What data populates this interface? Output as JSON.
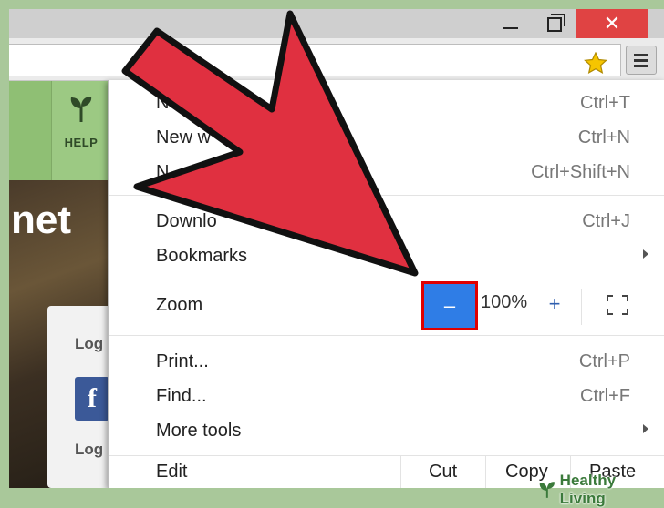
{
  "menu": {
    "items": [
      {
        "label": "N",
        "shortcut": "Ctrl+T"
      },
      {
        "label": "New w",
        "shortcut": "Ctrl+N"
      },
      {
        "label": "N",
        "shortcut": "Ctrl+Shift+N"
      },
      {
        "label": "Downlo",
        "shortcut": "Ctrl+J"
      },
      {
        "label": "Bookmarks",
        "shortcut": ""
      },
      {
        "label": "Print...",
        "shortcut": "Ctrl+P"
      },
      {
        "label": "Find...",
        "shortcut": "Ctrl+F"
      },
      {
        "label": "More tools",
        "shortcut": ""
      }
    ],
    "zoom": {
      "label": "Zoom",
      "minus": "–",
      "value": "100%",
      "plus": "+"
    },
    "edit": {
      "label": "Edit",
      "cut": "Cut",
      "copy": "Copy",
      "paste": "Paste"
    }
  },
  "page": {
    "nav_help": "HELP",
    "hero_text": "net",
    "login_label_1": "Log",
    "login_label_2": "Log",
    "facebook_letter": "f"
  },
  "window": {
    "close_glyph": "✕"
  },
  "watermark": "Healthy Living",
  "colors": {
    "arrow": "#e03040",
    "highlight": "#e00000",
    "zoom_button": "#2f7de6",
    "close_button": "#e04343"
  }
}
